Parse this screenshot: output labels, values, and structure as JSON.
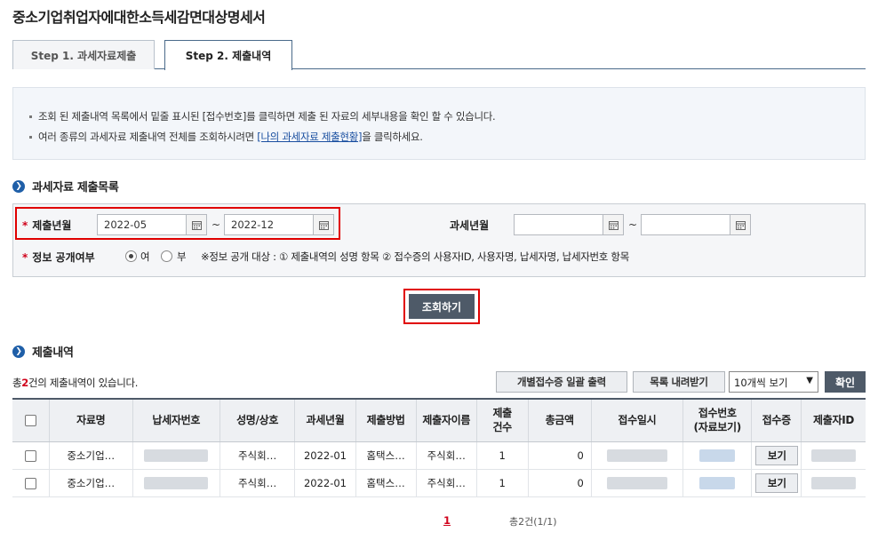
{
  "page_title": "중소기업취업자에대한소득세감면대상명세서",
  "tabs": [
    {
      "label": "Step 1. 과세자료제출",
      "active": false
    },
    {
      "label": "Step 2. 제출내역",
      "active": true
    }
  ],
  "info": {
    "line1": "조회 된 제출내역 목록에서 밑줄 표시된 [접수번호]를 클릭하면 제출 된 자료의 세부내용을 확인 할 수 있습니다.",
    "line2_prefix": "여러 종류의 과세자료 제출내역 전체를 조회하시려면 ",
    "line2_link": "[나의 과세자료 제출현황]",
    "line2_suffix": "을 클릭하세요."
  },
  "search_section": {
    "title": "과세자료 제출목록",
    "submit_month_label": "제출년월",
    "submit_from": "2022-05",
    "submit_to": "2022-12",
    "tax_month_label": "과세년월",
    "tax_from": "",
    "tax_to": "",
    "tilde": "~",
    "disclosure_label": "정보 공개여부",
    "disclosure_yes": "여",
    "disclosure_no": "부",
    "disclosure_selected": "여",
    "disclosure_note": "※정보 공개 대상 : ① 제출내역의 성명 항목 ② 접수증의 사용자ID, 사용자명, 납세자명, 납세자번호 항목",
    "search_button": "조회하기"
  },
  "results": {
    "title": "제출내역",
    "count_prefix": "총",
    "count": "2",
    "count_suffix": "건의 제출내역이 있습니다.",
    "batch_print_button": "개별접수증 일괄 출력",
    "download_button": "목록 내려받기",
    "page_size_option": "10개씩 보기",
    "confirm_button": "확인",
    "columns": [
      "자료명",
      "납세자번호",
      "성명/상호",
      "과세년월",
      "제출방법",
      "제출자이름",
      "제출\n건수",
      "총금액",
      "접수일시",
      "접수번호\n(자료보기)",
      "접수증",
      "제출자ID"
    ],
    "rows": [
      {
        "name": "중소기업…",
        "company": "주식회…",
        "tax_month": "2022-01",
        "method": "홈택스…",
        "submitter": "주식회…",
        "count": "1",
        "amount": "0",
        "receipt_button": "보기"
      },
      {
        "name": "중소기업…",
        "company": "주식회…",
        "tax_month": "2022-01",
        "method": "홈택스…",
        "submitter": "주식회…",
        "count": "1",
        "amount": "0",
        "receipt_button": "보기"
      }
    ]
  },
  "pager": {
    "current": "1",
    "total": "총2건(1/1)"
  },
  "colors": {
    "accent_blue": "#1f5fa8",
    "dark_button": "#4e5a68",
    "required_red": "#d0021b",
    "highlight_outline": "#e00000"
  }
}
